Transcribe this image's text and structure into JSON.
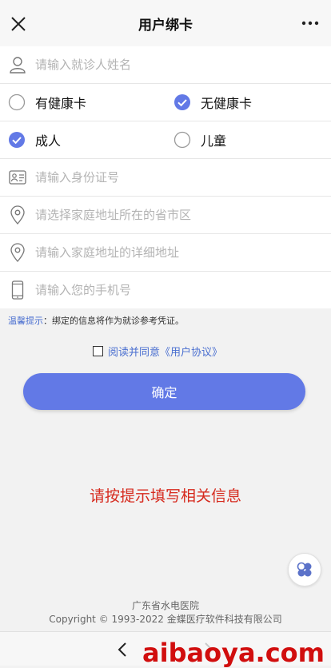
{
  "header": {
    "title": "用户绑卡",
    "close_icon": "close-icon",
    "more_icon": "more-icon"
  },
  "form": {
    "name": {
      "placeholder": "请输入就诊人姓名",
      "icon": "person-icon"
    },
    "card_type": {
      "options": [
        {
          "label": "有健康卡",
          "checked": false
        },
        {
          "label": "无健康卡",
          "checked": true
        }
      ]
    },
    "patient_type": {
      "options": [
        {
          "label": "成人",
          "checked": true
        },
        {
          "label": "儿童",
          "checked": false
        }
      ]
    },
    "id_number": {
      "placeholder": "请输入身份证号",
      "icon": "id-card-icon"
    },
    "region": {
      "placeholder": "请选择家庭地址所在的省市区",
      "icon": "location-pin-icon"
    },
    "address": {
      "placeholder": "请输入家庭地址的详细地址",
      "icon": "location-pin-icon"
    },
    "phone": {
      "placeholder": "请输入您的手机号",
      "icon": "phone-icon"
    }
  },
  "tip": {
    "key": "温馨提示",
    "text": "：绑定的信息将作为就诊参考凭证。"
  },
  "agreement": {
    "text": "阅读并同意《用户协议》",
    "checked": false
  },
  "confirm_label": "确定",
  "hint": "请按提示填写相关信息",
  "footer": {
    "hospital": "广东省水电医院",
    "copyright": "Copyright © 1993-2022 金蝶医疗软件科技有限公司"
  },
  "watermark": "aibaoya.com",
  "colors": {
    "accent": "#6279e6",
    "link": "#4a6fd0",
    "hint": "#d62a1e",
    "watermark": "#d10e0e"
  }
}
